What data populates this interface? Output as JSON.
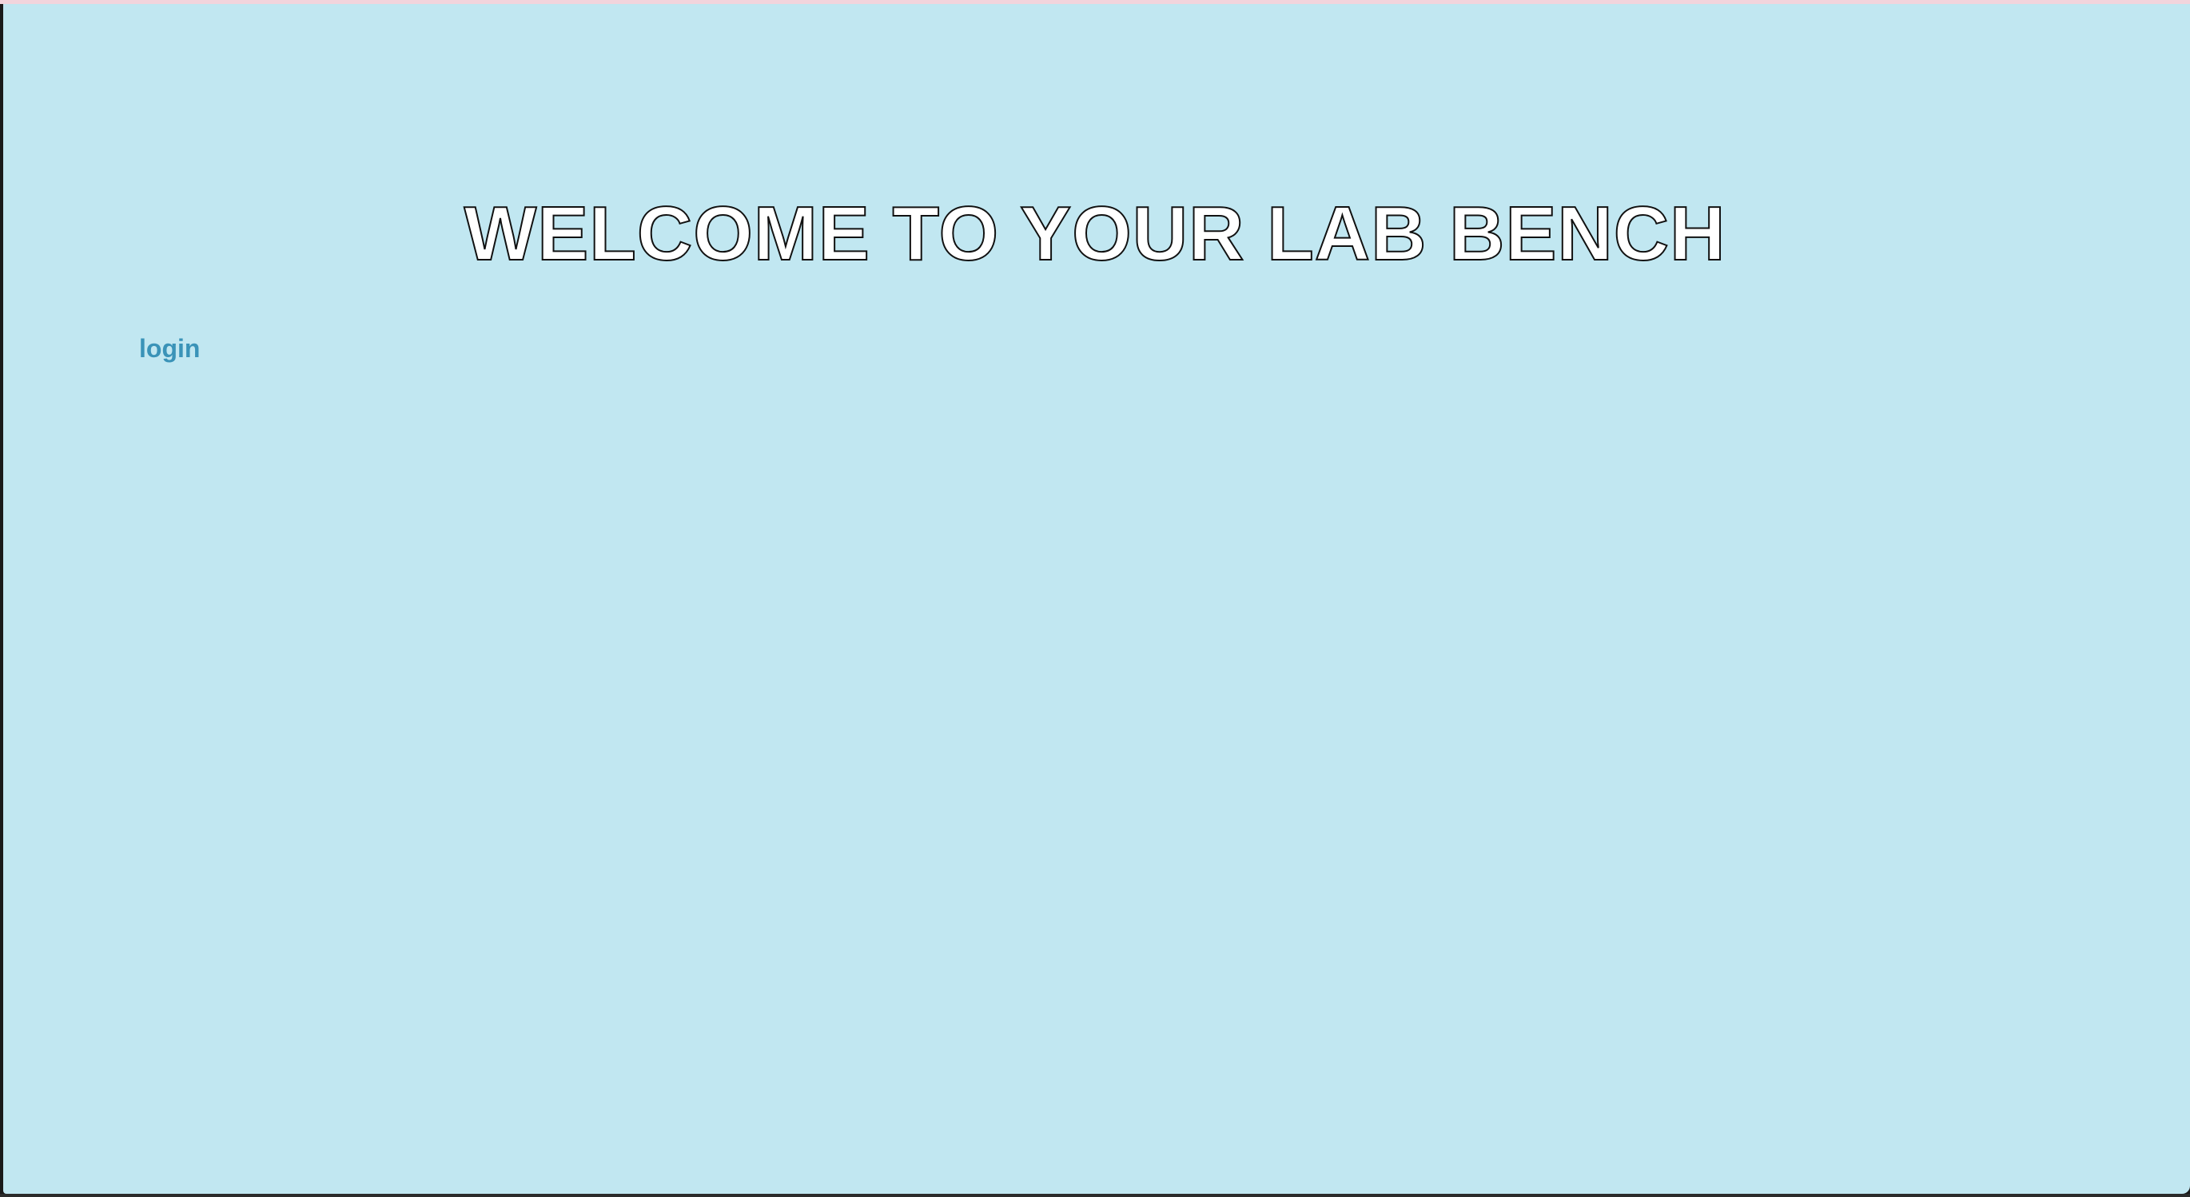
{
  "page": {
    "background_color": "#c1e7f1",
    "title": "WELCOME TO YOUR LAB BENCH"
  },
  "nav": {
    "login_label": "login",
    "link_color": "#3a93b8"
  }
}
